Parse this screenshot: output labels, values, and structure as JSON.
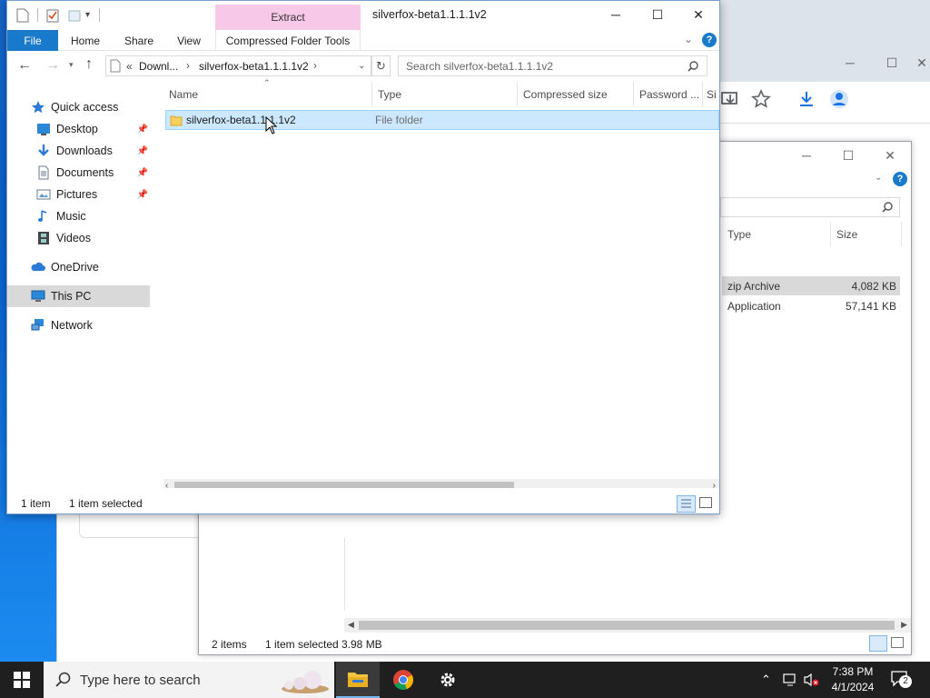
{
  "explorer": {
    "title": "silverfox-beta1.1.1.1v2",
    "context_tab": "Extract",
    "ribbon_tabs": [
      "File",
      "Home",
      "Share",
      "View",
      "Compressed Folder Tools"
    ],
    "nav_back": "←",
    "nav_forward": "→",
    "nav_up": "↑",
    "breadcrumb": {
      "overflow": "«",
      "segments": [
        "Downl...",
        "silverfox-beta1.1.1.1v2"
      ]
    },
    "search_placeholder": "Search silverfox-beta1.1.1.1v2",
    "navpane": {
      "quick_access": "Quick access",
      "pinned": [
        "Desktop",
        "Downloads",
        "Documents",
        "Pictures"
      ],
      "unpinned": [
        "Music",
        "Videos"
      ],
      "onedrive": "OneDrive",
      "this_pc": "This PC",
      "network": "Network"
    },
    "columns": [
      "Name",
      "Type",
      "Compressed size",
      "Password ...",
      "Si"
    ],
    "rows": [
      {
        "name": "silverfox-beta1.1.1.1v2",
        "type": "File folder"
      }
    ],
    "status": {
      "count": "1 item",
      "selected": "1 item selected"
    }
  },
  "zip_window": {
    "columns": [
      "Type",
      "Size"
    ],
    "rows": [
      {
        "type": "zip Archive",
        "size": "4,082 KB"
      },
      {
        "type": "Application",
        "size": "57,141 KB"
      }
    ],
    "status": {
      "count": "2 items",
      "selected": "1 item selected",
      "size": "3.98 MB"
    }
  },
  "taskbar": {
    "search_placeholder": "Type here to search",
    "time": "7:38 PM",
    "date": "4/1/2024",
    "notification_count": "2"
  },
  "colors": {
    "accent": "#1979ca",
    "extract_tab": "#f8c8e8",
    "selection": "#cce8ff"
  }
}
